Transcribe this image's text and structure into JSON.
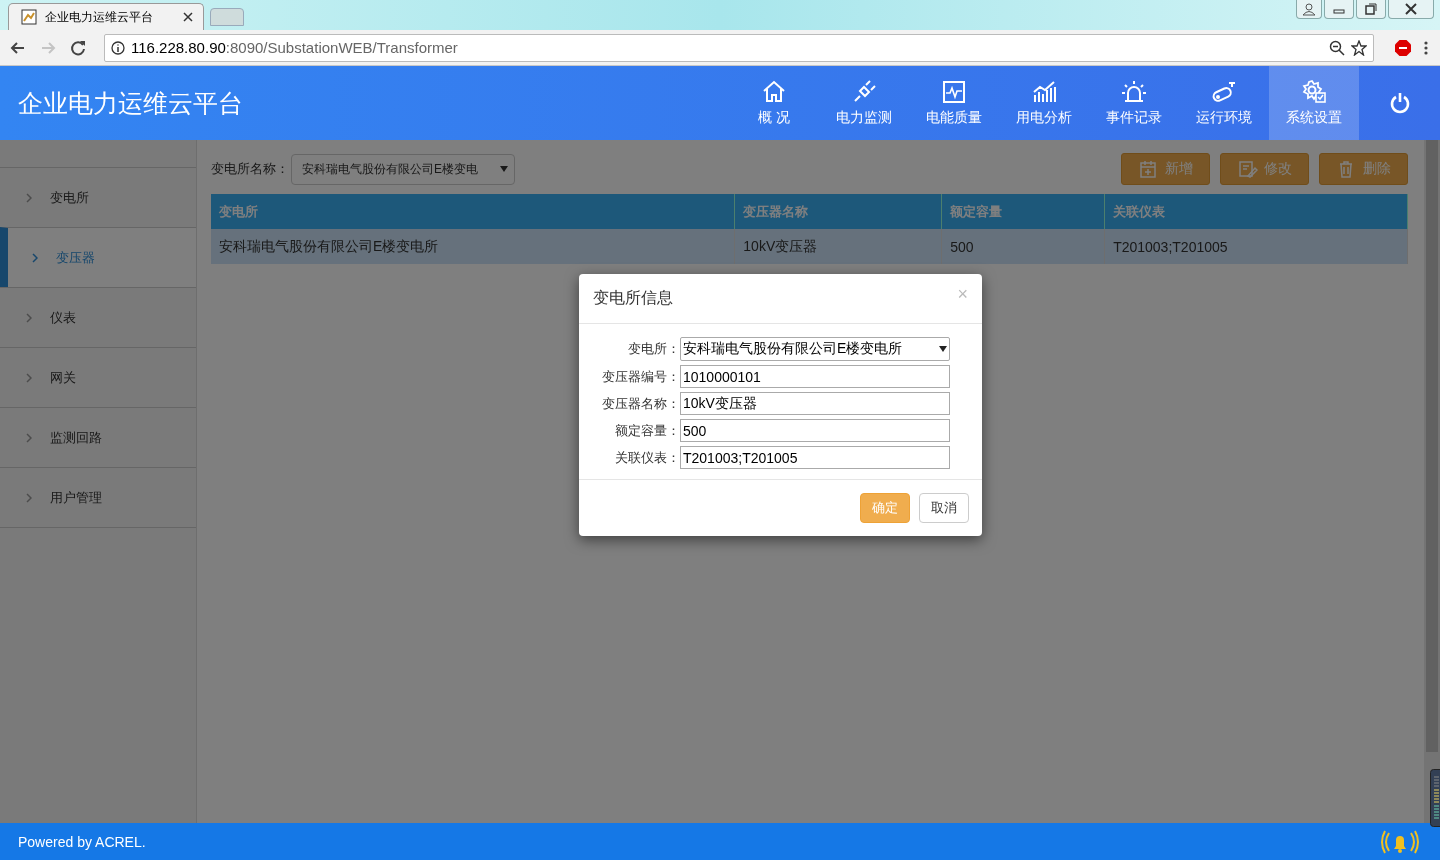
{
  "browser": {
    "tabs": [
      {
        "title": "企业电力运维云平台",
        "selected": true
      },
      {
        "selected": false
      }
    ],
    "nav_buttons": [
      {
        "disabled": false
      },
      {
        "disabled": true
      },
      {
        "disabled": false
      }
    ],
    "url": {
      "host": "116.228.80.90",
      "rest": ":8090/SubstationWEB/Transformer"
    }
  },
  "header": {
    "title": "企业电力运维云平台",
    "nav": [
      {
        "label": "概 况",
        "selected": false
      },
      {
        "label": "电力监测",
        "selected": false
      },
      {
        "label": "电能质量",
        "selected": false
      },
      {
        "label": "用电分析",
        "selected": false
      },
      {
        "label": "事件记录",
        "selected": false
      },
      {
        "label": "运行环境",
        "selected": false
      },
      {
        "label": "系统设置",
        "selected": true
      }
    ]
  },
  "sidebar": {
    "items": [
      {
        "label": "变电所",
        "selected": false
      },
      {
        "label": "变压器",
        "selected": true
      },
      {
        "label": "仪表",
        "selected": false
      },
      {
        "label": "网关",
        "selected": false
      },
      {
        "label": "监测回路",
        "selected": false
      },
      {
        "label": "用户管理",
        "selected": false
      }
    ]
  },
  "filter": {
    "label": "变电所名称：",
    "value": "安科瑞电气股份有限公司E楼变电"
  },
  "toolbar": [
    "新增",
    "修改",
    "删除"
  ],
  "table": {
    "columns": [
      "变电所",
      "变压器名称",
      "额定容量",
      "关联仪表"
    ],
    "rows": [
      {
        "cells": [
          "安科瑞电气股份有限公司E楼变电所",
          "10kV变压器",
          "500",
          "T201003;T201005"
        ],
        "selected": true
      }
    ]
  },
  "dialog": {
    "title": "变电所信息",
    "close": "×",
    "fields": [
      {
        "label": "变电所：",
        "value": "安科瑞电气股份有限公司E楼变电所",
        "kind": "select"
      },
      {
        "label": "变压器编号：",
        "value": "1010000101",
        "kind": "text"
      },
      {
        "label": "变压器名称：",
        "value": "10kV变压器",
        "kind": "text"
      },
      {
        "label": "额定容量：",
        "value": "500",
        "kind": "text"
      },
      {
        "label": "关联仪表：",
        "value": "T201003;T201005",
        "kind": "text"
      }
    ],
    "buttons": [
      {
        "label": "确定",
        "kind": "primary"
      },
      {
        "label": "取消",
        "kind": "default"
      }
    ]
  },
  "footer": {
    "text": "Powered by ACREL."
  }
}
